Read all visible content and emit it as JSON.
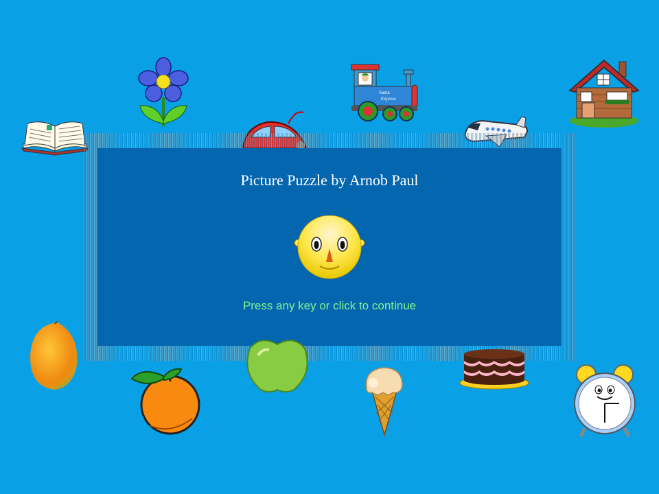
{
  "title": "Picture Puzzle by Arnob Paul",
  "prompt": "Press any key or click to continue",
  "train_sign": [
    "Santa",
    "Express"
  ],
  "background_color": "#0aa0e6",
  "dialog_color": "#0566b0",
  "prompt_color": "#7cf58c",
  "pictures": [
    "book",
    "flower",
    "car",
    "train",
    "airplane",
    "house",
    "mango",
    "orange",
    "apple",
    "ice-cream",
    "cake",
    "alarm-clock"
  ],
  "mascot": "smiley-face"
}
